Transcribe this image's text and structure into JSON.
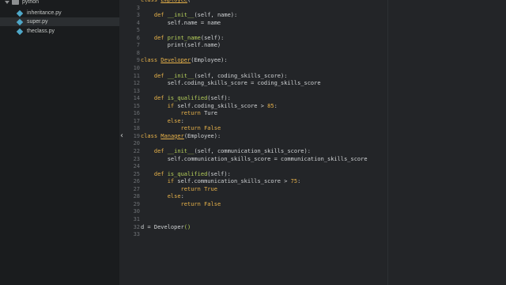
{
  "sidebar": {
    "folder": "python",
    "files": [
      {
        "name": "inheritance.py",
        "selected": false
      },
      {
        "name": "super.py",
        "selected": true
      },
      {
        "name": "theclass.py",
        "selected": false
      }
    ]
  },
  "editor": {
    "collapse_glyph": "‹",
    "lines": [
      {
        "n": "",
        "t": [
          [
            "kw",
            "class "
          ],
          [
            "cls",
            "Employee"
          ],
          [
            "",
            "("
          ]
        ]
      },
      {
        "n": "3",
        "t": [
          [
            "",
            ""
          ]
        ]
      },
      {
        "n": "3",
        "t": [
          [
            "",
            "    "
          ],
          [
            "kw",
            "def "
          ],
          [
            "fn",
            "__init__"
          ],
          [
            "",
            "(self, name):"
          ]
        ]
      },
      {
        "n": "4",
        "t": [
          [
            "",
            "        self.name = name"
          ]
        ]
      },
      {
        "n": "5",
        "t": [
          [
            "",
            ""
          ]
        ]
      },
      {
        "n": "6",
        "t": [
          [
            "",
            "    "
          ],
          [
            "kw",
            "def "
          ],
          [
            "fn",
            "print_name"
          ],
          [
            "",
            "(self):"
          ]
        ]
      },
      {
        "n": "7",
        "t": [
          [
            "",
            "        print(self.name)"
          ]
        ]
      },
      {
        "n": "8",
        "t": [
          [
            "",
            ""
          ]
        ]
      },
      {
        "n": "9",
        "t": [
          [
            "kw",
            "class "
          ],
          [
            "cls",
            "Developer"
          ],
          [
            "",
            "(Employee):"
          ]
        ]
      },
      {
        "n": "10",
        "t": [
          [
            "",
            ""
          ]
        ]
      },
      {
        "n": "11",
        "t": [
          [
            "",
            "    "
          ],
          [
            "kw",
            "def "
          ],
          [
            "fn",
            "__init__"
          ],
          [
            "",
            "(self, coding_skills_score):"
          ]
        ]
      },
      {
        "n": "12",
        "t": [
          [
            "",
            "        self.coding_skills_score = coding_skills_score"
          ]
        ]
      },
      {
        "n": "13",
        "t": [
          [
            "",
            ""
          ]
        ]
      },
      {
        "n": "14",
        "t": [
          [
            "",
            "    "
          ],
          [
            "kw",
            "def "
          ],
          [
            "fn",
            "is_qualified"
          ],
          [
            "",
            "(self):"
          ]
        ]
      },
      {
        "n": "15",
        "t": [
          [
            "",
            "        "
          ],
          [
            "kw",
            "if "
          ],
          [
            "",
            "self.coding_skills_score > "
          ],
          [
            "num",
            "85"
          ],
          [
            "",
            ":"
          ]
        ]
      },
      {
        "n": "16",
        "t": [
          [
            "",
            "            "
          ],
          [
            "kw",
            "return "
          ],
          [
            "",
            "Ture"
          ]
        ]
      },
      {
        "n": "17",
        "t": [
          [
            "",
            "        "
          ],
          [
            "kw",
            "else"
          ],
          [
            "",
            ":"
          ]
        ]
      },
      {
        "n": "18",
        "t": [
          [
            "",
            "            "
          ],
          [
            "kw",
            "return "
          ],
          [
            "const",
            "False"
          ]
        ]
      },
      {
        "n": "19",
        "t": [
          [
            "kw",
            "class "
          ],
          [
            "cls",
            "Manager"
          ],
          [
            "",
            "(Employee):"
          ]
        ]
      },
      {
        "n": "20",
        "t": [
          [
            "",
            ""
          ]
        ]
      },
      {
        "n": "22",
        "t": [
          [
            "",
            "    "
          ],
          [
            "kw",
            "def "
          ],
          [
            "fn",
            "__init__"
          ],
          [
            "",
            "(self, communication_skills_score):"
          ]
        ]
      },
      {
        "n": "23",
        "t": [
          [
            "",
            "        self.communication_skills_score = communication_skills_score"
          ]
        ]
      },
      {
        "n": "24",
        "t": [
          [
            "",
            ""
          ]
        ]
      },
      {
        "n": "25",
        "t": [
          [
            "",
            "    "
          ],
          [
            "kw",
            "def "
          ],
          [
            "fn",
            "is_qualified"
          ],
          [
            "",
            "(self):"
          ]
        ]
      },
      {
        "n": "26",
        "t": [
          [
            "",
            "        "
          ],
          [
            "kw",
            "if "
          ],
          [
            "",
            "self.communication_skills_score > "
          ],
          [
            "num",
            "75"
          ],
          [
            "",
            ":"
          ]
        ]
      },
      {
        "n": "27",
        "t": [
          [
            "",
            "            "
          ],
          [
            "kw",
            "return "
          ],
          [
            "const",
            "True"
          ]
        ]
      },
      {
        "n": "28",
        "t": [
          [
            "",
            "        "
          ],
          [
            "kw",
            "else"
          ],
          [
            "",
            ":"
          ]
        ]
      },
      {
        "n": "29",
        "t": [
          [
            "",
            "            "
          ],
          [
            "kw",
            "return "
          ],
          [
            "const",
            "False"
          ]
        ]
      },
      {
        "n": "30",
        "t": [
          [
            "",
            ""
          ]
        ]
      },
      {
        "n": "31",
        "t": [
          [
            "",
            ""
          ]
        ]
      },
      {
        "n": "32",
        "t": [
          [
            "",
            "d = Developer"
          ],
          [
            "fn",
            "()"
          ]
        ]
      },
      {
        "n": "33",
        "t": [
          [
            "",
            ""
          ]
        ]
      }
    ]
  }
}
